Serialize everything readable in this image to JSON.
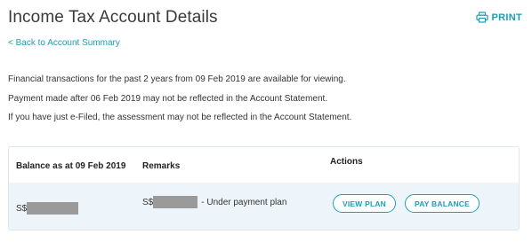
{
  "header": {
    "title": "Income Tax Account Details",
    "print_label": "PRINT",
    "print_icon": "printer-icon"
  },
  "nav": {
    "back_link": "< Back to Account Summary"
  },
  "info": {
    "line1": "Financial transactions for the past 2 years from 09 Feb 2019 are available for viewing.",
    "line2": "Payment made after 06 Feb 2019 may not be reflected in the Account Statement.",
    "line3": "If you have just e-Filed, the assessment may not be reflected in the Account Statement."
  },
  "table": {
    "headers": {
      "balance": "Balance as at 09 Feb 2019",
      "remarks": "Remarks",
      "actions": "Actions"
    },
    "rows": [
      {
        "balance_prefix": "S$",
        "remarks_prefix": "S$",
        "remarks_suffix": "- Under payment plan",
        "view_plan_label": "VIEW PLAN",
        "pay_balance_label": "PAY BALANCE"
      }
    ]
  },
  "colors": {
    "accent": "#1d9fb3",
    "row_background": "#eef5fa",
    "redaction": "#9a9a9a"
  }
}
